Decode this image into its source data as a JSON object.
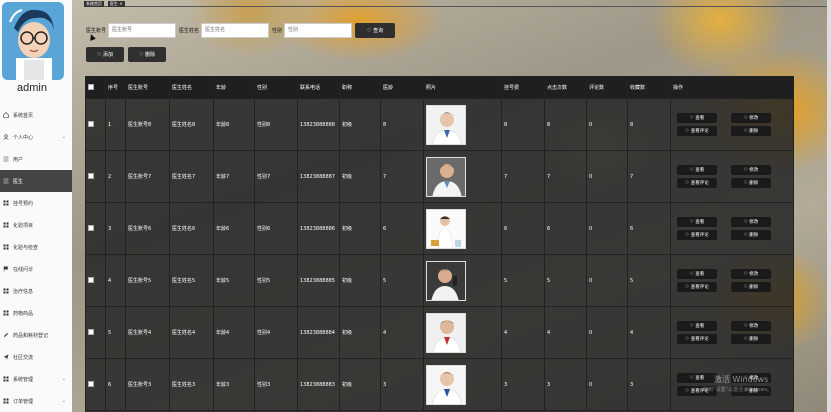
{
  "user": {
    "name": "admin"
  },
  "sidebar": {
    "items": [
      {
        "label": "系统首页",
        "icon": "home-icon",
        "active": false,
        "expand": false
      },
      {
        "label": "个人中心",
        "icon": "user-icon",
        "active": false,
        "expand": true
      },
      {
        "label": "用户",
        "icon": "list-icon",
        "active": false,
        "expand": false
      },
      {
        "label": "医生",
        "icon": "list-icon",
        "active": true,
        "expand": false
      },
      {
        "label": "挂号预约",
        "icon": "grid-icon",
        "active": false,
        "expand": false
      },
      {
        "label": "化验项目",
        "icon": "grid-icon",
        "active": false,
        "expand": false
      },
      {
        "label": "化验与检查",
        "icon": "grid-icon",
        "active": false,
        "expand": false
      },
      {
        "label": "在线问诊",
        "icon": "flag-icon",
        "active": false,
        "expand": false
      },
      {
        "label": "治疗信息",
        "icon": "grid-icon",
        "active": false,
        "expand": false
      },
      {
        "label": "药物商品",
        "icon": "grid-icon",
        "active": false,
        "expand": false
      },
      {
        "label": "药品和耗材登记",
        "icon": "pencil-icon",
        "active": false,
        "expand": false
      },
      {
        "label": "社区交流",
        "icon": "send-icon",
        "active": false,
        "expand": false
      },
      {
        "label": "系统管理",
        "icon": "grid-icon",
        "active": false,
        "expand": true
      },
      {
        "label": "订单管理",
        "icon": "grid-icon",
        "active": false,
        "expand": true
      }
    ]
  },
  "breadcrumb": [
    "系统首页",
    "医生 ×"
  ],
  "search": {
    "fields": [
      {
        "label": "医生账号",
        "placeholder": "医生账号"
      },
      {
        "label": "医生姓名",
        "placeholder": "医生姓名"
      },
      {
        "label": "性别",
        "placeholder": "性别"
      }
    ],
    "button": "♡ 查询"
  },
  "actions": {
    "add": "♡ 添加",
    "delete": "♡ 删除"
  },
  "table": {
    "headers": [
      "序号",
      "医生账号",
      "医生姓名",
      "年龄",
      "性别",
      "联系电话",
      "职称",
      "医龄",
      "照片",
      "挂号费",
      "点击次数",
      "评论数",
      "收藏数",
      "操作"
    ],
    "rows": [
      {
        "idx": "1",
        "account": "医生账号8",
        "name": "医生姓名8",
        "age": "年龄8",
        "gender": "性别8",
        "phone": "13823888888",
        "title": "初级",
        "years": "8",
        "fee": "8",
        "clicks": "8",
        "comments": "0",
        "favs": "8"
      },
      {
        "idx": "2",
        "account": "医生账号7",
        "name": "医生姓名7",
        "age": "年龄7",
        "gender": "性别7",
        "phone": "13823888887",
        "title": "初级",
        "years": "7",
        "fee": "7",
        "clicks": "7",
        "comments": "0",
        "favs": "7"
      },
      {
        "idx": "3",
        "account": "医生账号6",
        "name": "医生姓名6",
        "age": "年龄6",
        "gender": "性别6",
        "phone": "13823888886",
        "title": "初级",
        "years": "6",
        "fee": "6",
        "clicks": "6",
        "comments": "0",
        "favs": "6"
      },
      {
        "idx": "4",
        "account": "医生账号5",
        "name": "医生姓名5",
        "age": "年龄5",
        "gender": "性别5",
        "phone": "13823888885",
        "title": "初级",
        "years": "5",
        "fee": "5",
        "clicks": "5",
        "comments": "0",
        "favs": "5"
      },
      {
        "idx": "5",
        "account": "医生账号4",
        "name": "医生姓名4",
        "age": "年龄4",
        "gender": "性别4",
        "phone": "13823888884",
        "title": "初级",
        "years": "4",
        "fee": "4",
        "clicks": "4",
        "comments": "0",
        "favs": "4"
      },
      {
        "idx": "6",
        "account": "医生账号3",
        "name": "医生姓名3",
        "age": "年龄3",
        "gender": "性别3",
        "phone": "13823888883",
        "title": "初级",
        "years": "3",
        "fee": "3",
        "clicks": "3",
        "comments": "0",
        "favs": "3"
      }
    ],
    "ops": {
      "view": "♡ 查看",
      "edit": "♡ 修改",
      "comments": "♡ 查看评论",
      "delete": "♡ 删除"
    }
  },
  "watermark": {
    "line1": "激活 Windows",
    "line2": "转到“设置”以激活 Windows。"
  }
}
